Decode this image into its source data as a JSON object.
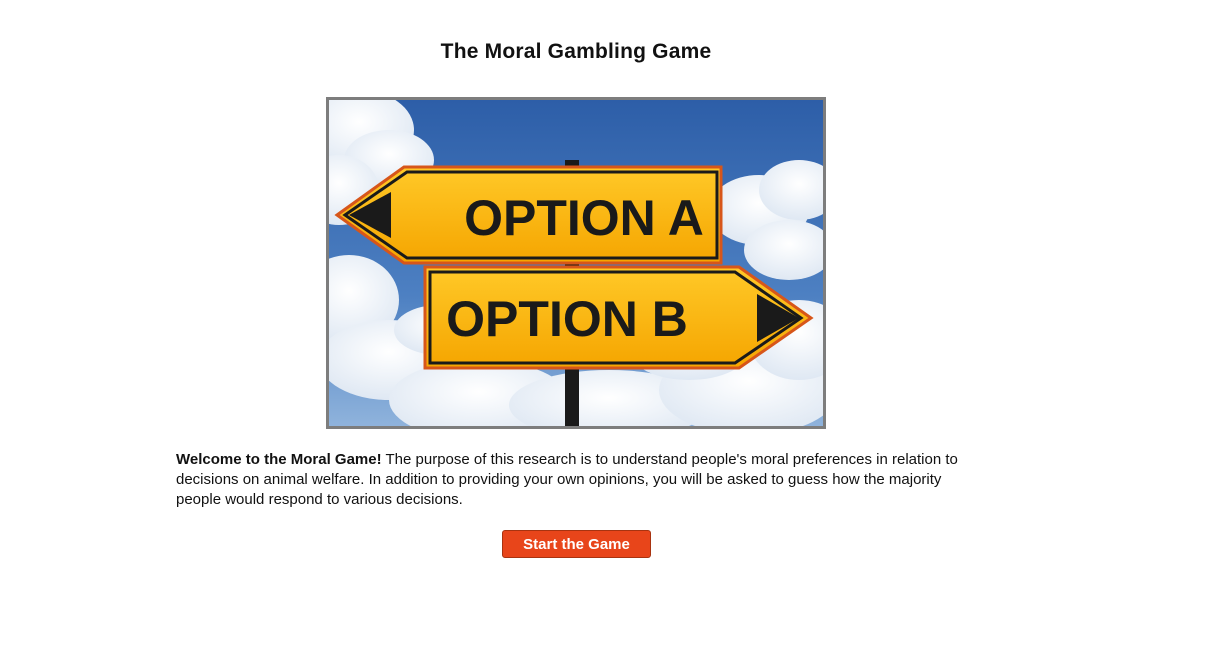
{
  "page": {
    "title": "The Moral Gambling Game"
  },
  "hero_image": {
    "sign_top": "OPTION A",
    "sign_bottom": "OPTION B"
  },
  "intro": {
    "lead": "Welcome to the Moral Game!",
    "body": " The purpose of this research is to understand people's moral preferences in relation to decisions on animal welfare. In addition to providing your own opinions, you will be asked to guess how the majority people would respond to various decisions."
  },
  "actions": {
    "start_label": "Start the Game"
  },
  "colors": {
    "button": "#e8451a",
    "sign_yellow": "#f9b70f",
    "sky": "#3f6fb0",
    "frame": "#7d7d7d"
  }
}
